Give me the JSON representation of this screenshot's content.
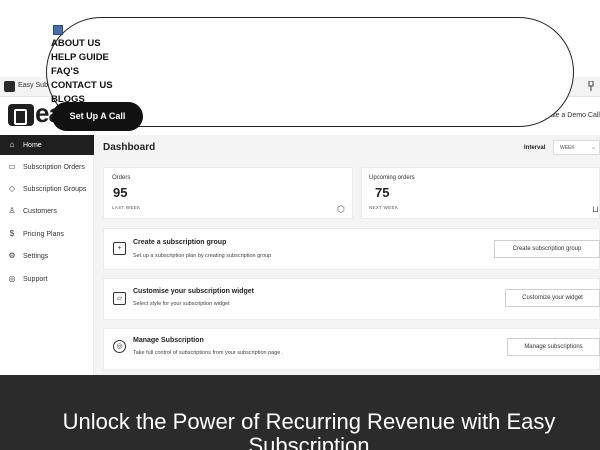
{
  "app": {
    "title": "Easy Subs",
    "brand": "ea",
    "demo_link": "ule a Demo Call"
  },
  "sidebar": {
    "items": [
      {
        "label": "Home",
        "icon": "home-icon",
        "glyph": "⌂"
      },
      {
        "label": "Subscription Orders",
        "icon": "inbox-icon",
        "glyph": "▭"
      },
      {
        "label": "Subscription Groups",
        "icon": "tag-icon",
        "glyph": "◇"
      },
      {
        "label": "Customers",
        "icon": "user-icon",
        "glyph": "♙"
      },
      {
        "label": "Pricing Plans",
        "icon": "dollar-icon",
        "glyph": "$"
      },
      {
        "label": "Settings",
        "icon": "gear-icon",
        "glyph": "⚙"
      },
      {
        "label": "Support",
        "icon": "help-icon",
        "glyph": "◎"
      }
    ]
  },
  "dashboard": {
    "title": "Dashboard",
    "interval_label": "Interval",
    "interval_value": "WEEK",
    "stats": [
      {
        "label": "Orders",
        "value": "95",
        "sub": "LAST WEEK"
      },
      {
        "label": "Upcoming orders",
        "value": "75",
        "sub": "NEXT WEEK"
      }
    ],
    "actions": [
      {
        "title": "Create a subscription group",
        "desc": "Set up a subscription plan by creating subscription group",
        "button": "Create subscription group"
      },
      {
        "title": "Customise your subscription widget",
        "desc": "Select style for your subscription widget",
        "button": "Customize your widget"
      },
      {
        "title": "Manage Subscription",
        "desc": "Take full control of subscriptions from your subscription page .",
        "button": "Manage subscriptions"
      }
    ]
  },
  "nav_menu": {
    "items": [
      "ABOUT US",
      "HELP GUIDE",
      "FAQ'S",
      "CONTACT US",
      "BLOGS"
    ],
    "cta": "Set Up A Call"
  },
  "banner": {
    "title": "Unlock the Power of Recurring Revenue with Easy Subscription"
  },
  "colors": {
    "dark": "#1f1f1f",
    "banner": "#2b2b2b",
    "main_bg": "#f4f4f4"
  }
}
